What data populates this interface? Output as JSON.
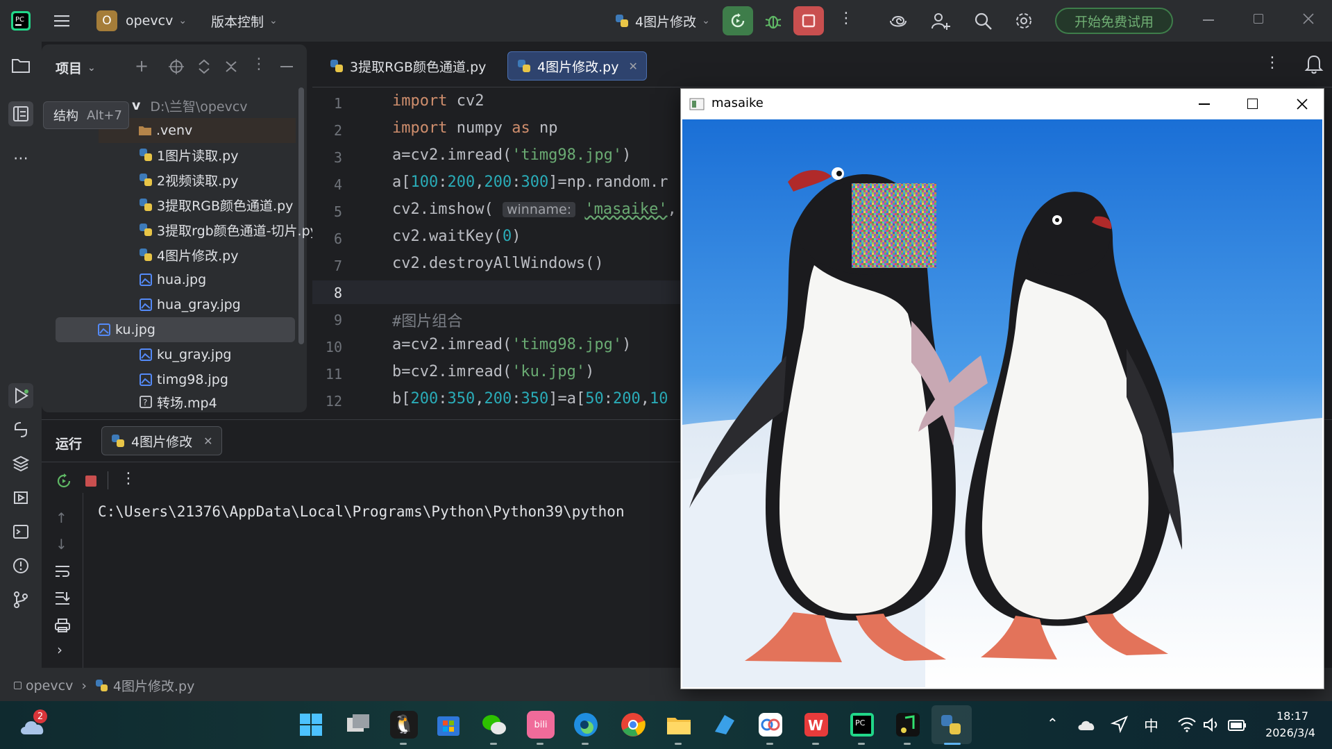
{
  "titlebar": {
    "project_badge": "O",
    "project_name": "opevcv",
    "vcs_menu": "版本控制",
    "run_config": "4图片修改",
    "trial_button": "开始免费试用"
  },
  "project_panel": {
    "title": "项目",
    "root_label": "v",
    "root_path": "D:\\兰智\\opevcv",
    "tooltip_label": "结构",
    "tooltip_shortcut": "Alt+7",
    "items": [
      {
        "name": ".venv"
      },
      {
        "name": "1图片读取.py"
      },
      {
        "name": "2视频读取.py"
      },
      {
        "name": "3提取RGB颜色通道.py"
      },
      {
        "name": "3提取rgb颜色通道-切片.py"
      },
      {
        "name": "4图片修改.py"
      },
      {
        "name": "hua.jpg"
      },
      {
        "name": "hua_gray.jpg"
      },
      {
        "name": "ku.jpg"
      },
      {
        "name": "ku_gray.jpg"
      },
      {
        "name": "timg98.jpg"
      },
      {
        "name": "转场.mp4"
      }
    ]
  },
  "editor": {
    "tabs": [
      {
        "label": "3提取RGB颜色通道.py"
      },
      {
        "label": "4图片修改.py"
      }
    ],
    "line_numbers": [
      "1",
      "2",
      "3",
      "4",
      "5",
      "6",
      "7",
      "8",
      "9",
      "10",
      "11",
      "12"
    ],
    "inlay_hint": "winname:"
  },
  "run_panel": {
    "title": "运行",
    "tab_label": "4图片修改",
    "console_line": "C:\\Users\\21376\\AppData\\Local\\Programs\\Python\\Python39\\python"
  },
  "statusbar": {
    "crumb_project": "opevcv",
    "crumb_file": "4图片修改.py"
  },
  "cv_window": {
    "title": "masaike"
  },
  "taskbar": {
    "weather_badge": "2",
    "input_method": "中",
    "time": "18:17",
    "date": "2026/3/4"
  },
  "colors": {
    "accent": "#3574f0",
    "keyword": "#cf8e6d",
    "string": "#6aab73",
    "number": "#2aacb8",
    "stop_red": "#c94f4f",
    "run_green": "#3e7d4a"
  }
}
